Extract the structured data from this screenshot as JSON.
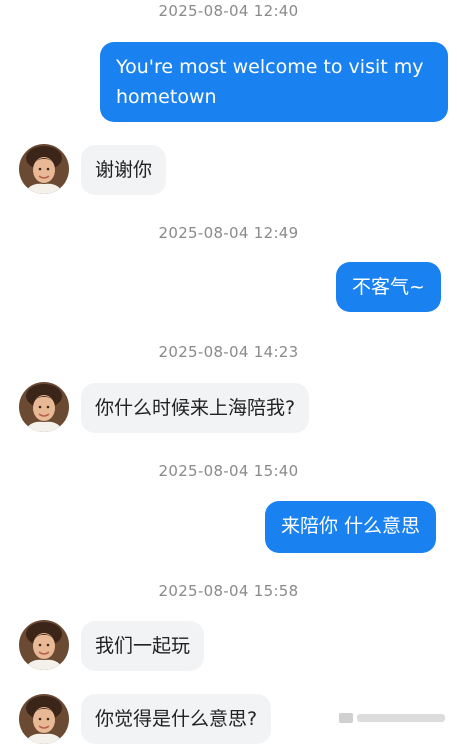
{
  "messages": [
    {
      "timestamp": "2025-08-04 12:40"
    },
    {
      "side": "out",
      "text": "You're most welcome to visit my hometown"
    },
    {
      "side": "in",
      "text": "谢谢你"
    },
    {
      "timestamp": "2025-08-04 12:49"
    },
    {
      "side": "out",
      "text": "不客气~"
    },
    {
      "timestamp": "2025-08-04 14:23"
    },
    {
      "side": "in",
      "text": "你什么时候来上海陪我?"
    },
    {
      "timestamp": "2025-08-04 15:40"
    },
    {
      "side": "out",
      "text": "来陪你 什么意思"
    },
    {
      "timestamp": "2025-08-04 15:58"
    },
    {
      "side": "in",
      "text": "我们一起玩"
    },
    {
      "side": "in",
      "text": "你觉得是什么意思?"
    }
  ],
  "colors": {
    "outgoing_bubble": "#1a82f0",
    "incoming_bubble": "#f2f3f5",
    "timestamp_text": "#8a8a8a"
  }
}
